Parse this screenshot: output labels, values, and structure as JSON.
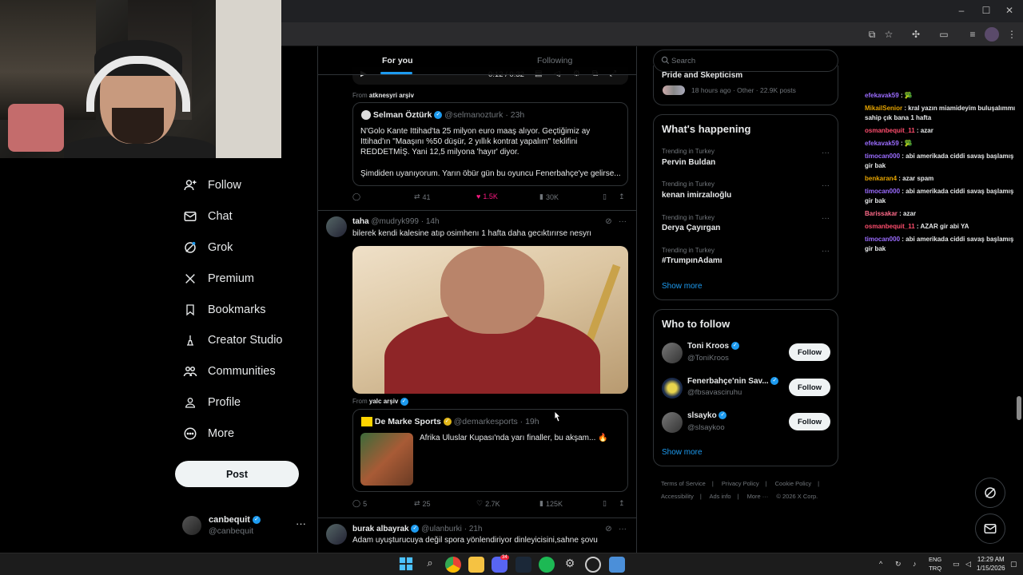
{
  "browser": {
    "window_controls": [
      "–",
      "☐",
      "✕"
    ],
    "toolbar_icons": [
      "cast-icon",
      "star-icon",
      "extensions-icon",
      "sidebar-icon",
      "reading-list-icon",
      "profile-icon",
      "menu-icon"
    ]
  },
  "nav": {
    "items": [
      {
        "label": "Follow",
        "icon": "follow-icon"
      },
      {
        "label": "Chat",
        "icon": "chat-icon"
      },
      {
        "label": "Grok",
        "icon": "grok-icon"
      },
      {
        "label": "Premium",
        "icon": "x-logo-icon"
      },
      {
        "label": "Bookmarks",
        "icon": "bookmark-icon"
      },
      {
        "label": "Creator Studio",
        "icon": "creator-studio-icon"
      },
      {
        "label": "Communities",
        "icon": "communities-icon"
      },
      {
        "label": "Profile",
        "icon": "profile-icon"
      },
      {
        "label": "More",
        "icon": "more-circle-icon"
      }
    ],
    "post_label": "Post",
    "account": {
      "name": "canbequit",
      "handle": "@canbequit",
      "more": "···"
    }
  },
  "feed": {
    "tabs": {
      "active": "For you",
      "inactive": "Following"
    },
    "video_time": "0:12 / 0:32",
    "tweet1": {
      "from_prefix": "From",
      "from_name": "atknesyri arşiv",
      "quote": {
        "name": "Selman Öztürk",
        "handle": "@selmanozturk",
        "time": "23h",
        "line1": "N'Golo Kante Ittihad'ta 25 milyon euro maaş alıyor. Geçtiğimiz ay",
        "line2": "Ittihad'ın \"Maaşını %50 düşür, 2 yıllık kontrat yapalım\" teklifini",
        "line3": "REDDETMİŞ. Yani 12,5 milyona 'hayır' diyor.",
        "line4": "Şimdiden uyanıyorum. Yarın öbür gün bu oyuncu Fenerbahçe'ye gelirse..."
      },
      "actions": {
        "replies": "",
        "reposts": "41",
        "likes": "1.5K",
        "views": "30K"
      }
    },
    "tweet2": {
      "name": "taha",
      "handle": "@mudryk999",
      "time": "14h",
      "text": "bilerek kendi kalesine atıp osimhenı 1 hafta daha gecıktırırse nesyrı",
      "from_prefix": "From",
      "from_name": "yalc arşiv",
      "quote": {
        "name": "De Marke Sports",
        "handle": "@demarkesports",
        "time": "19h",
        "text": "Afrika Uluslar Kupası'nda yarı finaller, bu akşam... 🔥"
      },
      "actions": {
        "replies": "5",
        "reposts": "25",
        "likes": "2.7K",
        "views": "125K"
      }
    },
    "tweet3": {
      "name": "burak albayrak",
      "handle": "@ulanburki",
      "time": "21h",
      "text": "Adam uyuşturucuya değil spora yönlendiriyor dinleyicisini,sahne şovu"
    }
  },
  "sidebar": {
    "search_placeholder": "Search",
    "top_card": {
      "title": "Pride and Skepticism",
      "meta": "18 hours ago · Other · 22.9K posts"
    },
    "happening": {
      "title": "What's happening",
      "trends": [
        {
          "category": "Trending in Turkey",
          "name": "Pervin Buldan"
        },
        {
          "category": "Trending in Turkey",
          "name": "kenan imirzalıoğlu"
        },
        {
          "category": "Trending in Turkey",
          "name": "Derya Çayırgan"
        },
        {
          "category": "Trending in Turkey",
          "name": "#TrumpınAdamı"
        }
      ],
      "show_more": "Show more"
    },
    "who_to_follow": {
      "title": "Who to follow",
      "accounts": [
        {
          "name": "Toni Kroos",
          "handle": "@ToniKroos",
          "button": "Follow"
        },
        {
          "name": "Fenerbahçe'nin Sav...",
          "handle": "@fbsavasciruhu",
          "button": "Follow"
        },
        {
          "name": "slsayko",
          "handle": "@slsaykoo",
          "button": "Follow"
        }
      ],
      "show_more": "Show more"
    },
    "footer": {
      "line1": [
        "Terms of Service",
        "|",
        "Privacy Policy",
        "|",
        "Cookie Policy",
        "|"
      ],
      "line2": [
        "Accessibility",
        "|",
        "Ads info",
        "|",
        "More ···",
        "© 2026 X Corp."
      ]
    }
  },
  "chat": [
    {
      "user": "efekavak59",
      "color": "#9b6cff",
      "msg": ": 🥦"
    },
    {
      "user": "MikailSenior",
      "color": "#e6a400",
      "msg": ": kral yazın miamideyim buluşalımmı sahip çık bana 1 hafta"
    },
    {
      "user": "osmanbequit_11",
      "color": "#ff4d6d",
      "msg": ": azar"
    },
    {
      "user": "efekavak59",
      "color": "#9b6cff",
      "msg": ": 🥦"
    },
    {
      "user": "timocan000",
      "color": "#9b6cff",
      "msg": ": abi amerikada ciddi savaş başlamış gir bak"
    },
    {
      "user": "benkaran4",
      "color": "#e6a400",
      "msg": ": azar spam"
    },
    {
      "user": "timocan000",
      "color": "#9b6cff",
      "msg": ": abi amerikada ciddi savaş başlamış gir bak"
    },
    {
      "user": "Barissakar",
      "color": "#ff6b8a",
      "msg": ": azar"
    },
    {
      "user": "osmanbequit_11",
      "color": "#ff4d6d",
      "msg": ": AZAR gir abi YA"
    },
    {
      "user": "timocan000",
      "color": "#9b6cff",
      "msg": ": abi amerikada ciddi savaş başlamış gir bak"
    }
  ],
  "taskbar": {
    "lang_top": "ENG",
    "lang_bottom": "TRQ",
    "time": "12:29 AM",
    "date": "1/15/2026",
    "notif_badge": "34"
  }
}
